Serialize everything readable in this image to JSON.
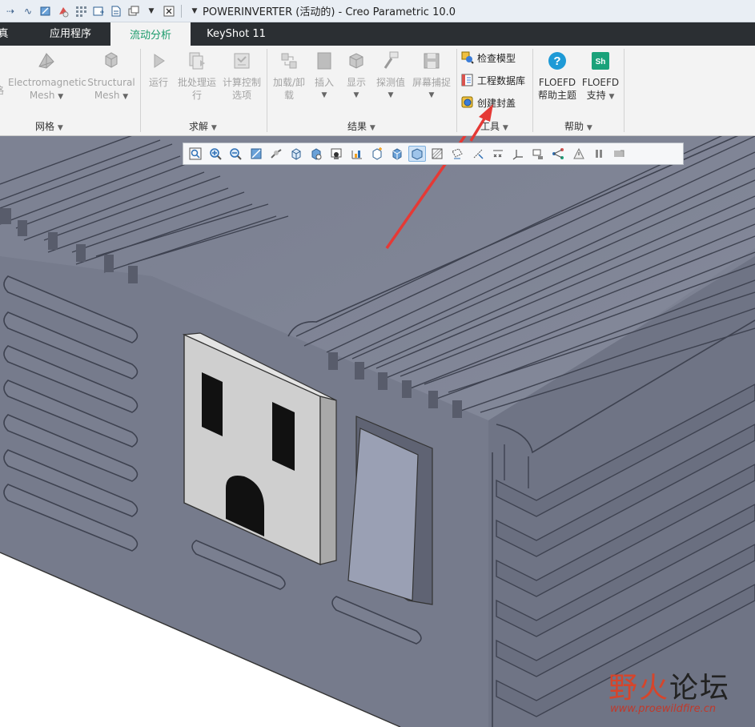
{
  "window": {
    "title": "POWERINVERTER (活动的) - Creo Parametric 10.0"
  },
  "quick_access": {
    "icons": [
      "redo-icon",
      "wave-icon",
      "regenerate-icon",
      "color-icon",
      "grid-icon",
      "window-icon",
      "sheet-icon",
      "window-list-icon",
      "more-dropdown-icon",
      "close-window-icon"
    ]
  },
  "tabs": [
    {
      "label": "仿真",
      "visible_text": "真"
    },
    {
      "label": "应用程序"
    },
    {
      "label": "流动分析",
      "active": true
    },
    {
      "label": "KeyShot 11"
    }
  ],
  "ribbon": {
    "groups": {
      "mesh": {
        "label": "网格",
        "buttons": [
          {
            "label": "格",
            "disabled": true
          },
          {
            "label_line1": "Electromagnetic",
            "label_line2": "Mesh",
            "disabled": true
          },
          {
            "label_line1": "Structural",
            "label_line2": "Mesh",
            "disabled": true
          }
        ]
      },
      "solve": {
        "label": "求解",
        "buttons": [
          {
            "label": "运行",
            "disabled": true
          },
          {
            "label_line1": "批处理运",
            "label_line2": "行",
            "disabled": true
          },
          {
            "label_line1": "计算控制",
            "label_line2": "选项",
            "disabled": true
          }
        ]
      },
      "results": {
        "label": "结果",
        "buttons": [
          {
            "label_line1": "加载/卸",
            "label_line2": "载",
            "disabled": true
          },
          {
            "label": "插入",
            "disabled": true
          },
          {
            "label": "显示",
            "disabled": true
          },
          {
            "label": "探测值",
            "disabled": true
          },
          {
            "label": "屏幕捕捉",
            "disabled": true
          }
        ]
      },
      "tools": {
        "label": "工具",
        "buttons": [
          {
            "label": "检查模型"
          },
          {
            "label": "工程数据库"
          },
          {
            "label": "创建封盖"
          }
        ]
      },
      "help": {
        "label": "帮助",
        "buttons": [
          {
            "label_line1": "FLOEFD",
            "label_line2": "帮助主题"
          },
          {
            "label_line1": "FLOEFD",
            "label_line2": "支持"
          }
        ]
      }
    }
  },
  "graphics_toolbar": {
    "icons": [
      "refit-icon",
      "zoom-in-icon",
      "zoom-out-icon",
      "repaint-icon",
      "spin-center-icon",
      "named-views-icon",
      "saved-orientations-icon",
      "section-icon",
      "perspective-icon",
      "annotation-icon",
      "view-manager-icon",
      "display-style-icon",
      "shading-icon",
      "datum-planes-icon",
      "datum-axes-icon",
      "datum-points-icon",
      "csys-icon",
      "rotation-center-icon",
      "spin-icon",
      "annotations-display-icon",
      "pause-icon",
      "capture-icon"
    ]
  },
  "watermark": {
    "main": "野火论坛",
    "accent": "野火",
    "rest": "论坛",
    "url": "www.proewildfire.cn"
  },
  "colors": {
    "active_tab_text": "#1a9b6b",
    "tab_bar": "#2b2f33",
    "model": "#7d8293",
    "annotation_arrow": "#e53935"
  }
}
